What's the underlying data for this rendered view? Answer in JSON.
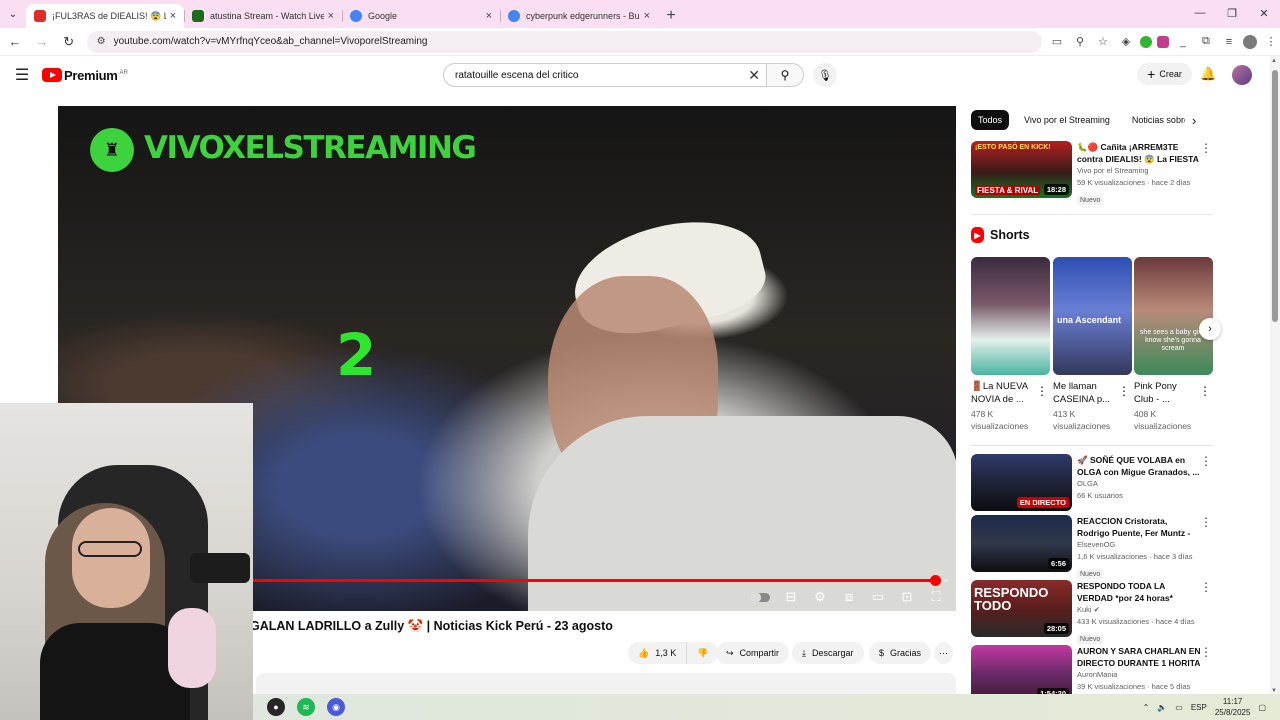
{
  "browser": {
    "tabs": [
      {
        "label": "¡FUL3RAS de DIEALIS! 😨 La",
        "active": true,
        "color": "#e02b2b"
      },
      {
        "label": "atustina Stream - Watch Live on",
        "active": false,
        "color": "#1b6b1b"
      },
      {
        "label": "Google",
        "active": false,
        "color": "#4285f4"
      },
      {
        "label": "cyberpunk edgerunners - Busca",
        "active": false,
        "color": "#4285f4"
      }
    ],
    "url": "youtube.com/watch?v=vMYrfnqYceo&ab_channel=VivoporelStreaming"
  },
  "youtube": {
    "logo_text": "Premium",
    "logo_region": "AR",
    "search_value": "ratatouille escena del critico",
    "create_label": "Crear"
  },
  "player": {
    "watermark": "VIVOXELSTREAMING",
    "overlay_number": "2",
    "progress": 0.985
  },
  "video": {
    "title": "GALAN LADRILLO a Zully 🤡 | Noticias Kick Perú - 23 agosto",
    "likes": "1,3 K",
    "share_label": "Compartir",
    "download_label": "Descargar",
    "thanks_label": "Gracias"
  },
  "sidebar": {
    "chips": [
      "Todos",
      "Vivo por el Streaming",
      "Noticias sobre p"
    ],
    "first": {
      "title": "🐛🔴 Cañita ¡ARREM3TE contra DIEALIS! 😨 La FIESTA ...",
      "channel": "Vivo por el Streaming",
      "stats": "59 K visualizaciones · hace 2 días",
      "badge": "Nuevo",
      "duration": "18:28",
      "thumb_text": "¡ESTO PASÓ EN KICK!",
      "thumb_sub": "FIESTA & RIVAL"
    },
    "shorts_title": "Shorts",
    "shorts": [
      {
        "title": "🚪La NUEVA NOVIA de ...",
        "views": "478 K visualizaciones"
      },
      {
        "title": "Me llaman CASEINA p...",
        "views": "413 K visualizaciones",
        "overlay": "una Ascendant"
      },
      {
        "title": "Pink Pony Club - ...",
        "views": "408 K visualizaciones",
        "overlay": "she sees a baby girl I know she's gonna scream"
      }
    ],
    "videos": [
      {
        "title": "🚀 SOÑÉ QUE VOLABA en OLGA con Migue Granados, ...",
        "channel": "OLGA",
        "stats": "66 K usuarios",
        "live": "EN DIRECTO"
      },
      {
        "title": "REACCION Cristorata, Rodrigo Puente, Fer Muntz - Noiseteo ...",
        "channel": "ElsevenOG",
        "stats": "1,6 K visualizaciones · hace 3 días",
        "badge": "Nuevo",
        "duration": "6:56"
      },
      {
        "title": "RESPONDO TODA LA VERDAD *por 24 horas*",
        "channel": "Kuki ✔",
        "stats": "433 K visualizaciones · hace 4 días",
        "badge": "Nuevo",
        "duration": "28:05",
        "thumb_text": "RESPONDO TODO"
      },
      {
        "title": "AURON Y SARA CHARLAN EN DIRECTO DURANTE 1 HORITA",
        "channel": "AuronMania",
        "stats": "39 K visualizaciones · hace 5 días",
        "duration": "1:54:20"
      }
    ]
  },
  "taskbar": {
    "lang": "ESP",
    "time": "11:17",
    "date": "25/8/2025"
  }
}
